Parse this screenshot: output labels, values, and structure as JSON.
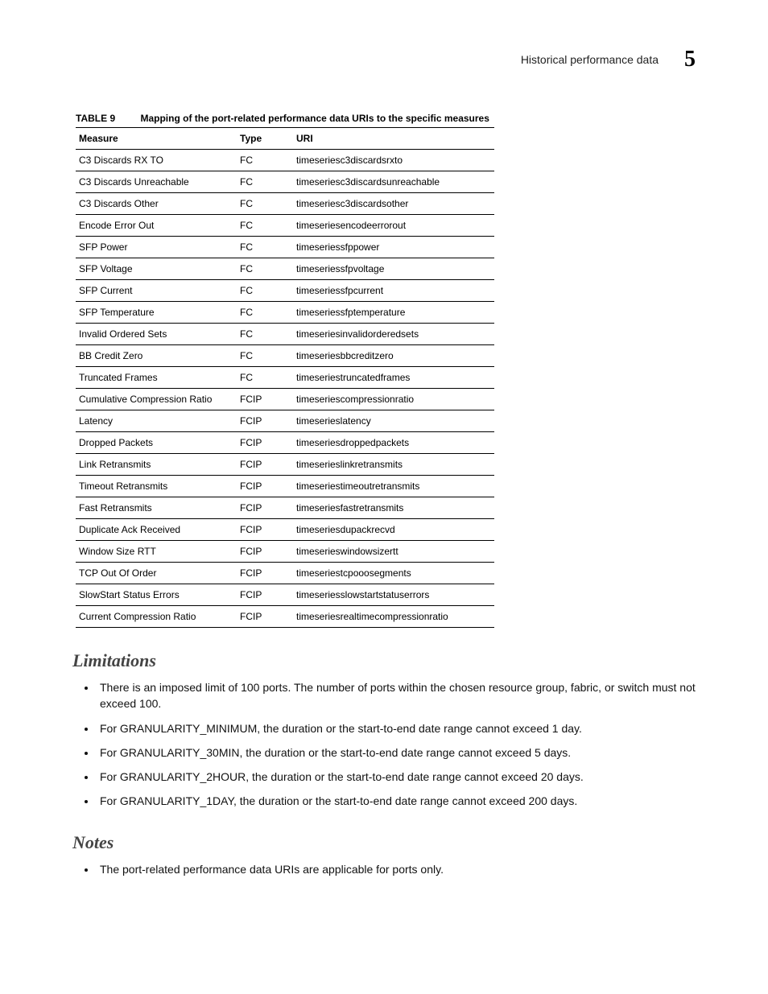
{
  "header": {
    "running_title": "Historical performance data",
    "chapter_number": "5"
  },
  "table": {
    "label": "TABLE 9",
    "title": "Mapping of the port-related performance data URIs to the specific measures",
    "columns": {
      "measure": "Measure",
      "type": "Type",
      "uri": "URI"
    },
    "rows": [
      {
        "measure": "C3 Discards RX TO",
        "type": "FC",
        "uri": "timeseriesc3discardsrxto"
      },
      {
        "measure": "C3 Discards Unreachable",
        "type": "FC",
        "uri": "timeseriesc3discardsunreachable"
      },
      {
        "measure": "C3 Discards Other",
        "type": "FC",
        "uri": "timeseriesc3discardsother"
      },
      {
        "measure": "Encode Error Out",
        "type": "FC",
        "uri": "timeseriesencodeerrorout"
      },
      {
        "measure": "SFP Power",
        "type": "FC",
        "uri": "timeseriessfppower"
      },
      {
        "measure": "SFP Voltage",
        "type": "FC",
        "uri": "timeseriessfpvoltage"
      },
      {
        "measure": "SFP Current",
        "type": "FC",
        "uri": "timeseriessfpcurrent"
      },
      {
        "measure": "SFP Temperature",
        "type": "FC",
        "uri": "timeseriessfptemperature"
      },
      {
        "measure": "Invalid Ordered Sets",
        "type": "FC",
        "uri": "timeseriesinvalidorderedsets"
      },
      {
        "measure": "BB Credit Zero",
        "type": "FC",
        "uri": "timeseriesbbcreditzero"
      },
      {
        "measure": "Truncated Frames",
        "type": "FC",
        "uri": "timeseriestruncatedframes"
      },
      {
        "measure": "Cumulative Compression Ratio",
        "type": "FCIP",
        "uri": "timeseriescompressionratio"
      },
      {
        "measure": "Latency",
        "type": "FCIP",
        "uri": "timeserieslatency"
      },
      {
        "measure": "Dropped Packets",
        "type": "FCIP",
        "uri": "timeseriesdroppedpackets"
      },
      {
        "measure": "Link Retransmits",
        "type": "FCIP",
        "uri": "timeserieslinkretransmits"
      },
      {
        "measure": "Timeout Retransmits",
        "type": "FCIP",
        "uri": "timeseriestimeoutretransmits"
      },
      {
        "measure": "Fast Retransmits",
        "type": "FCIP",
        "uri": "timeseriesfastretransmits"
      },
      {
        "measure": "Duplicate Ack Received",
        "type": "FCIP",
        "uri": "timeseriesdupackrecvd"
      },
      {
        "measure": "Window Size RTT",
        "type": "FCIP",
        "uri": "timeserieswindowsizertt"
      },
      {
        "measure": "TCP Out Of Order",
        "type": "FCIP",
        "uri": "timeseriestcpooosegments"
      },
      {
        "measure": "SlowStart Status Errors",
        "type": "FCIP",
        "uri": "timeseriesslowstartstatuserrors"
      },
      {
        "measure": "Current Compression Ratio",
        "type": "FCIP",
        "uri": "timeseriesrealtimecompressionratio"
      }
    ]
  },
  "sections": {
    "limitations": {
      "heading": "Limitations",
      "items": [
        "There is an imposed limit of 100 ports. The number of ports within the chosen resource group, fabric, or switch must not exceed 100.",
        "For GRANULARITY_MINIMUM, the duration or the start-to-end date range cannot exceed 1 day.",
        "For GRANULARITY_30MIN, the duration or the start-to-end date range cannot exceed 5 days.",
        "For GRANULARITY_2HOUR, the duration or the start-to-end date range cannot exceed 20 days.",
        "For GRANULARITY_1DAY, the duration or the start-to-end date range cannot exceed 200 days."
      ]
    },
    "notes": {
      "heading": "Notes",
      "items": [
        "The port-related performance data URIs are applicable for ports only."
      ]
    }
  }
}
